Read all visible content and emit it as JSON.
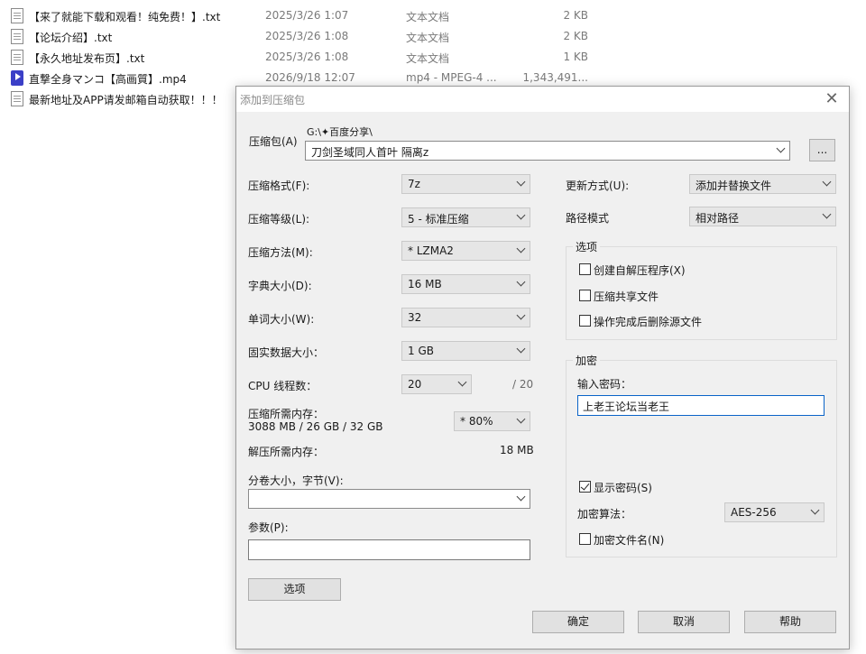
{
  "files": [
    {
      "icon": "text-document-icon",
      "name": "【来了就能下载和观看！纯免费！】.txt",
      "date": "2025/3/26 1:07",
      "type": "文本文档",
      "size": "2 KB"
    },
    {
      "icon": "text-document-icon",
      "name": "【论坛介绍】.txt",
      "date": "2025/3/26 1:08",
      "type": "文本文档",
      "size": "2 KB"
    },
    {
      "icon": "text-document-icon",
      "name": "【永久地址发布页】.txt",
      "date": "2025/3/26 1:08",
      "type": "文本文档",
      "size": "1 KB"
    },
    {
      "icon": "video-file-icon",
      "name": "直撃全身マンコ【高画質】.mp4",
      "date": "2026/9/18 12:07",
      "type": "mp4 - MPEG-4 ...",
      "size": "1,343,491..."
    },
    {
      "icon": "text-document-icon",
      "name": "最新地址及APP请发邮箱自动获取！！！",
      "date": "",
      "type": "",
      "size": ""
    }
  ],
  "dialog": {
    "title": "添加到压缩包",
    "close": "✕",
    "archive_label": "压缩包(A)",
    "archive_path": "G:\\✦百度分享\\",
    "archive_name": "刀剑圣域同人首叶 隔离z",
    "browse_label": "...",
    "format_label": "压缩格式(F):",
    "format_value": "7z",
    "level_label": "压缩等级(L):",
    "level_value": "5 - 标准压缩",
    "method_label": "压缩方法(M):",
    "method_value": "* LZMA2",
    "dict_label": "字典大小(D):",
    "dict_value": "16 MB",
    "word_label": "单词大小(W):",
    "word_value": "32",
    "solid_label": "固实数据大小：",
    "solid_value": "1 GB",
    "threads_label": "CPU 线程数：",
    "threads_value": "20",
    "threads_max": "/ 20",
    "mem_comp_label": "压缩所需内存：",
    "mem_comp_value": "3088 MB / 26 GB / 32 GB",
    "mem_percent": "* 80%",
    "mem_decomp_label": "解压所需内存：",
    "mem_decomp_value": "18 MB",
    "volume_label": "分卷大小，字节(V):",
    "volume_value": "",
    "params_label": "参数(P):",
    "params_value": "",
    "options_button": "选项",
    "update_label": "更新方式(U):",
    "update_value": "添加并替换文件",
    "path_mode_label": "路径模式",
    "path_mode_value": "相对路径",
    "options_group": "选项",
    "opt_sfx": "创建自解压程序(X)",
    "opt_shared": "压缩共享文件",
    "opt_delete": "操作完成后删除源文件",
    "encrypt_group": "加密",
    "password_label": "输入密码：",
    "password_value": "上老王论坛当老王",
    "show_password": "显示密码(S)",
    "enc_method_label": "加密算法：",
    "enc_method_value": "AES-256",
    "enc_names": "加密文件名(N)",
    "ok": "确定",
    "cancel": "取消",
    "help": "帮助"
  }
}
